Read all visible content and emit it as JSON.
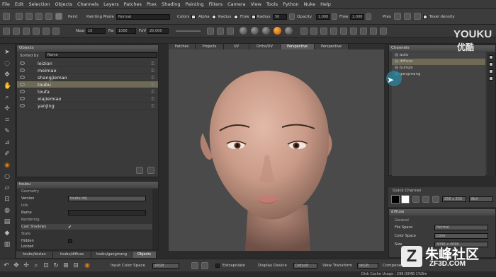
{
  "menu": [
    "File",
    "Edit",
    "Selection",
    "Objects",
    "Channels",
    "Layers",
    "Patches",
    "Ptex",
    "Shading",
    "Painting",
    "Filters",
    "Camera",
    "View",
    "Tools",
    "Python",
    "Nuke",
    "Help"
  ],
  "toolbar": {
    "paint_label": "Paint",
    "painting_mode_label": "Painting Mode",
    "painting_mode_value": "Normal",
    "colors_label": "Colors",
    "alpha_label": "Alpha",
    "radius_label": "Radius",
    "flow_label": "Flow",
    "radius2_label": "Radius",
    "radius2_value": "50",
    "opacity_label": "Opacity",
    "opacity_value": "1.000",
    "flow2_label": "Flow",
    "flow2_value": "1.000",
    "ptex_label": "Ptex",
    "texel_density_label": "Texel density",
    "near_label": "Near",
    "near_value": "10",
    "far_label": "Far",
    "far_value": "1000",
    "fov_label": "FoV",
    "fov_value": "20.000"
  },
  "objects_panel": {
    "title": "Objects",
    "sorted_by_label": "Sorted by",
    "sorted_by_value": "Name",
    "items": [
      {
        "name": "leizian",
        "selected": false
      },
      {
        "name": "meimao",
        "selected": false
      },
      {
        "name": "shangjiemao",
        "selected": false
      },
      {
        "name": "toubu",
        "selected": true
      },
      {
        "name": "toufa",
        "selected": false
      },
      {
        "name": "xiajiemiao",
        "selected": false
      },
      {
        "name": "yanjing",
        "selected": false
      }
    ]
  },
  "properties_panel": {
    "title": "toubu",
    "geometry_section": "Geometry",
    "version_label": "Version",
    "version_value": "toubu.obj",
    "info_section": "Info",
    "name_label": "Name",
    "name_value": "toubu",
    "rendering_section": "Rendering",
    "cast_shadows_label": "Cast Shadows",
    "state_section": "State",
    "hidden_label": "Hidden",
    "locked_label": "Locked"
  },
  "bottom_tabs": [
    "toubu/leizian",
    "toubu/diffuse",
    "toubu/gangmang",
    "Objects"
  ],
  "viewport_tabs": [
    "Patches",
    "Projects",
    "UV",
    "Ortho/UV",
    "Perspective",
    "Perspective"
  ],
  "channels_panel": {
    "title": "Channels",
    "items": [
      {
        "name": "auto",
        "selected": false
      },
      {
        "name": "diffuse",
        "selected": true
      },
      {
        "name": "bumps",
        "selected": false
      },
      {
        "name": "gangmang",
        "selected": false
      }
    ],
    "quick_channel_label": "Quick Channel",
    "size_value": "256 x 256",
    "mode_value": "8bit"
  },
  "diffuse_props": {
    "title": "diffuse",
    "general_section": "General",
    "file_space_label": "File Space",
    "file_space_value": "Normal",
    "color_space_label": "Color Space",
    "color_space_value": "Color",
    "size_label": "Size",
    "size_value": "4096 x 4096"
  },
  "bottom_bar": {
    "input_color_space_label": "Input Color Space",
    "input_color_space_value": "sRGB",
    "extrapolate_label": "Extrapolate",
    "display_device_label": "Display Device",
    "display_device_value": "Default",
    "view_transform_label": "View Transform",
    "view_transform_value": "sRGB",
    "component_label": "Component"
  },
  "status": {
    "disk_cache": "Disk Cache Usage : 298.00MB 1%Bm"
  },
  "watermarks": {
    "youku_en": "YOUKU",
    "youku_cn": "优酷",
    "zf3d_cn": "朱峰社区",
    "zf3d_url": "ZF3D.COM",
    "zf3d_logo": "Z"
  },
  "colors": {
    "selected_row": "#6f6a55",
    "orange_accent": "#e07a10"
  }
}
